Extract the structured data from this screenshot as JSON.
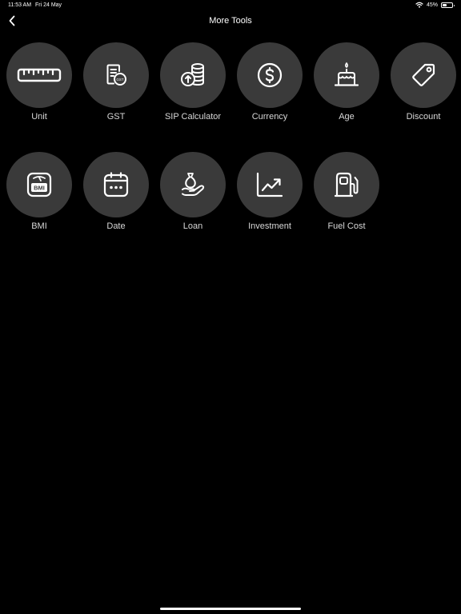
{
  "status_bar": {
    "time": "11:53 AM",
    "date": "Fri 24 May",
    "battery_text": "45%",
    "battery_level": 0.45
  },
  "header": {
    "title": "More Tools"
  },
  "tools": [
    {
      "label": "Unit",
      "icon": "ruler-icon"
    },
    {
      "label": "GST",
      "icon": "gst-receipt-icon"
    },
    {
      "label": "SIP Calculator",
      "icon": "coins-stack-icon"
    },
    {
      "label": "Currency",
      "icon": "dollar-circle-icon"
    },
    {
      "label": "Age",
      "icon": "birthday-cake-icon"
    },
    {
      "label": "Discount",
      "icon": "price-tag-icon"
    },
    {
      "label": "BMI",
      "icon": "bmi-scale-icon"
    },
    {
      "label": "Date",
      "icon": "calendar-icon"
    },
    {
      "label": "Loan",
      "icon": "hand-money-bag-icon"
    },
    {
      "label": "Investment",
      "icon": "trend-chart-icon"
    },
    {
      "label": "Fuel Cost",
      "icon": "fuel-pump-icon"
    }
  ],
  "colors": {
    "background": "#000000",
    "tile": "#3a3a3a",
    "icon": "#ffffff",
    "label": "#d8d8d8"
  }
}
